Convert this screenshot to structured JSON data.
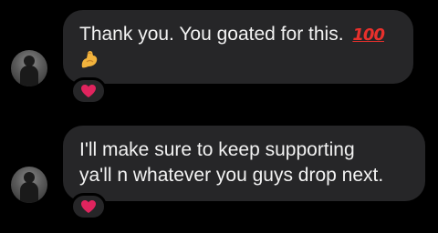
{
  "messages": [
    {
      "text": "Thank you. You goated for this.",
      "emoji_hundred": "💯",
      "emoji_muscle": "💪",
      "reaction": "❤️",
      "avatar_icon": "user-avatar"
    },
    {
      "line1": "I'll make sure to keep supporting",
      "line2": "ya'll n whatever you guys drop next.",
      "reaction": "❤️",
      "avatar_icon": "user-avatar"
    }
  ],
  "colors": {
    "background": "#000000",
    "bubble": "#262628",
    "text": "#f2f2f2",
    "heart": "#e0245e"
  }
}
